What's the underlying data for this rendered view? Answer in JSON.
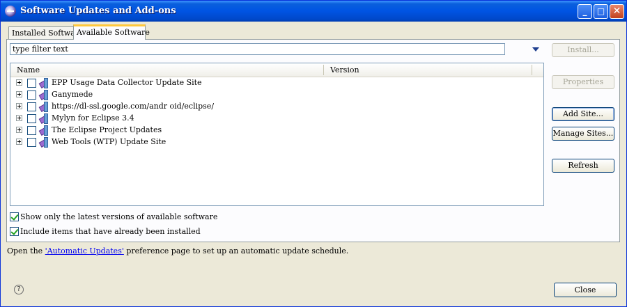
{
  "window": {
    "title": "Software Updates and Add-ons",
    "controls": {
      "minimize": "_",
      "maximize": "□",
      "close": "✕"
    }
  },
  "tabs": [
    {
      "label": "Installed Software",
      "active": false
    },
    {
      "label": "Available Software",
      "active": true
    }
  ],
  "filter": {
    "value": "type filter text"
  },
  "tree": {
    "columns": [
      "Name",
      "Version"
    ],
    "rows": [
      {
        "label": "EPP Usage Data Collector Update Site",
        "checked": false
      },
      {
        "label": "Ganymede",
        "checked": false
      },
      {
        "label": "https://dl-ssl.google.com/andr oid/eclipse/",
        "checked": false
      },
      {
        "label": "Mylyn for Eclipse 3.4",
        "checked": false
      },
      {
        "label": "The Eclipse Project Updates",
        "checked": false
      },
      {
        "label": "Web Tools (WTP) Update Site",
        "checked": false
      }
    ]
  },
  "buttons": {
    "install": "Install...",
    "properties": "Properties",
    "add_site": "Add Site...",
    "manage_sites": "Manage Sites...",
    "refresh": "Refresh",
    "close": "Close"
  },
  "options": {
    "latest_only": {
      "label": "Show only the latest versions of available software",
      "checked": true
    },
    "include_installed": {
      "label": "Include items that have already been installed",
      "checked": true
    }
  },
  "footer": {
    "prefix": "Open the ",
    "link": "'Automatic Updates'",
    "suffix": " preference page to set up an automatic update schedule."
  },
  "help": {
    "glyph": "?"
  }
}
